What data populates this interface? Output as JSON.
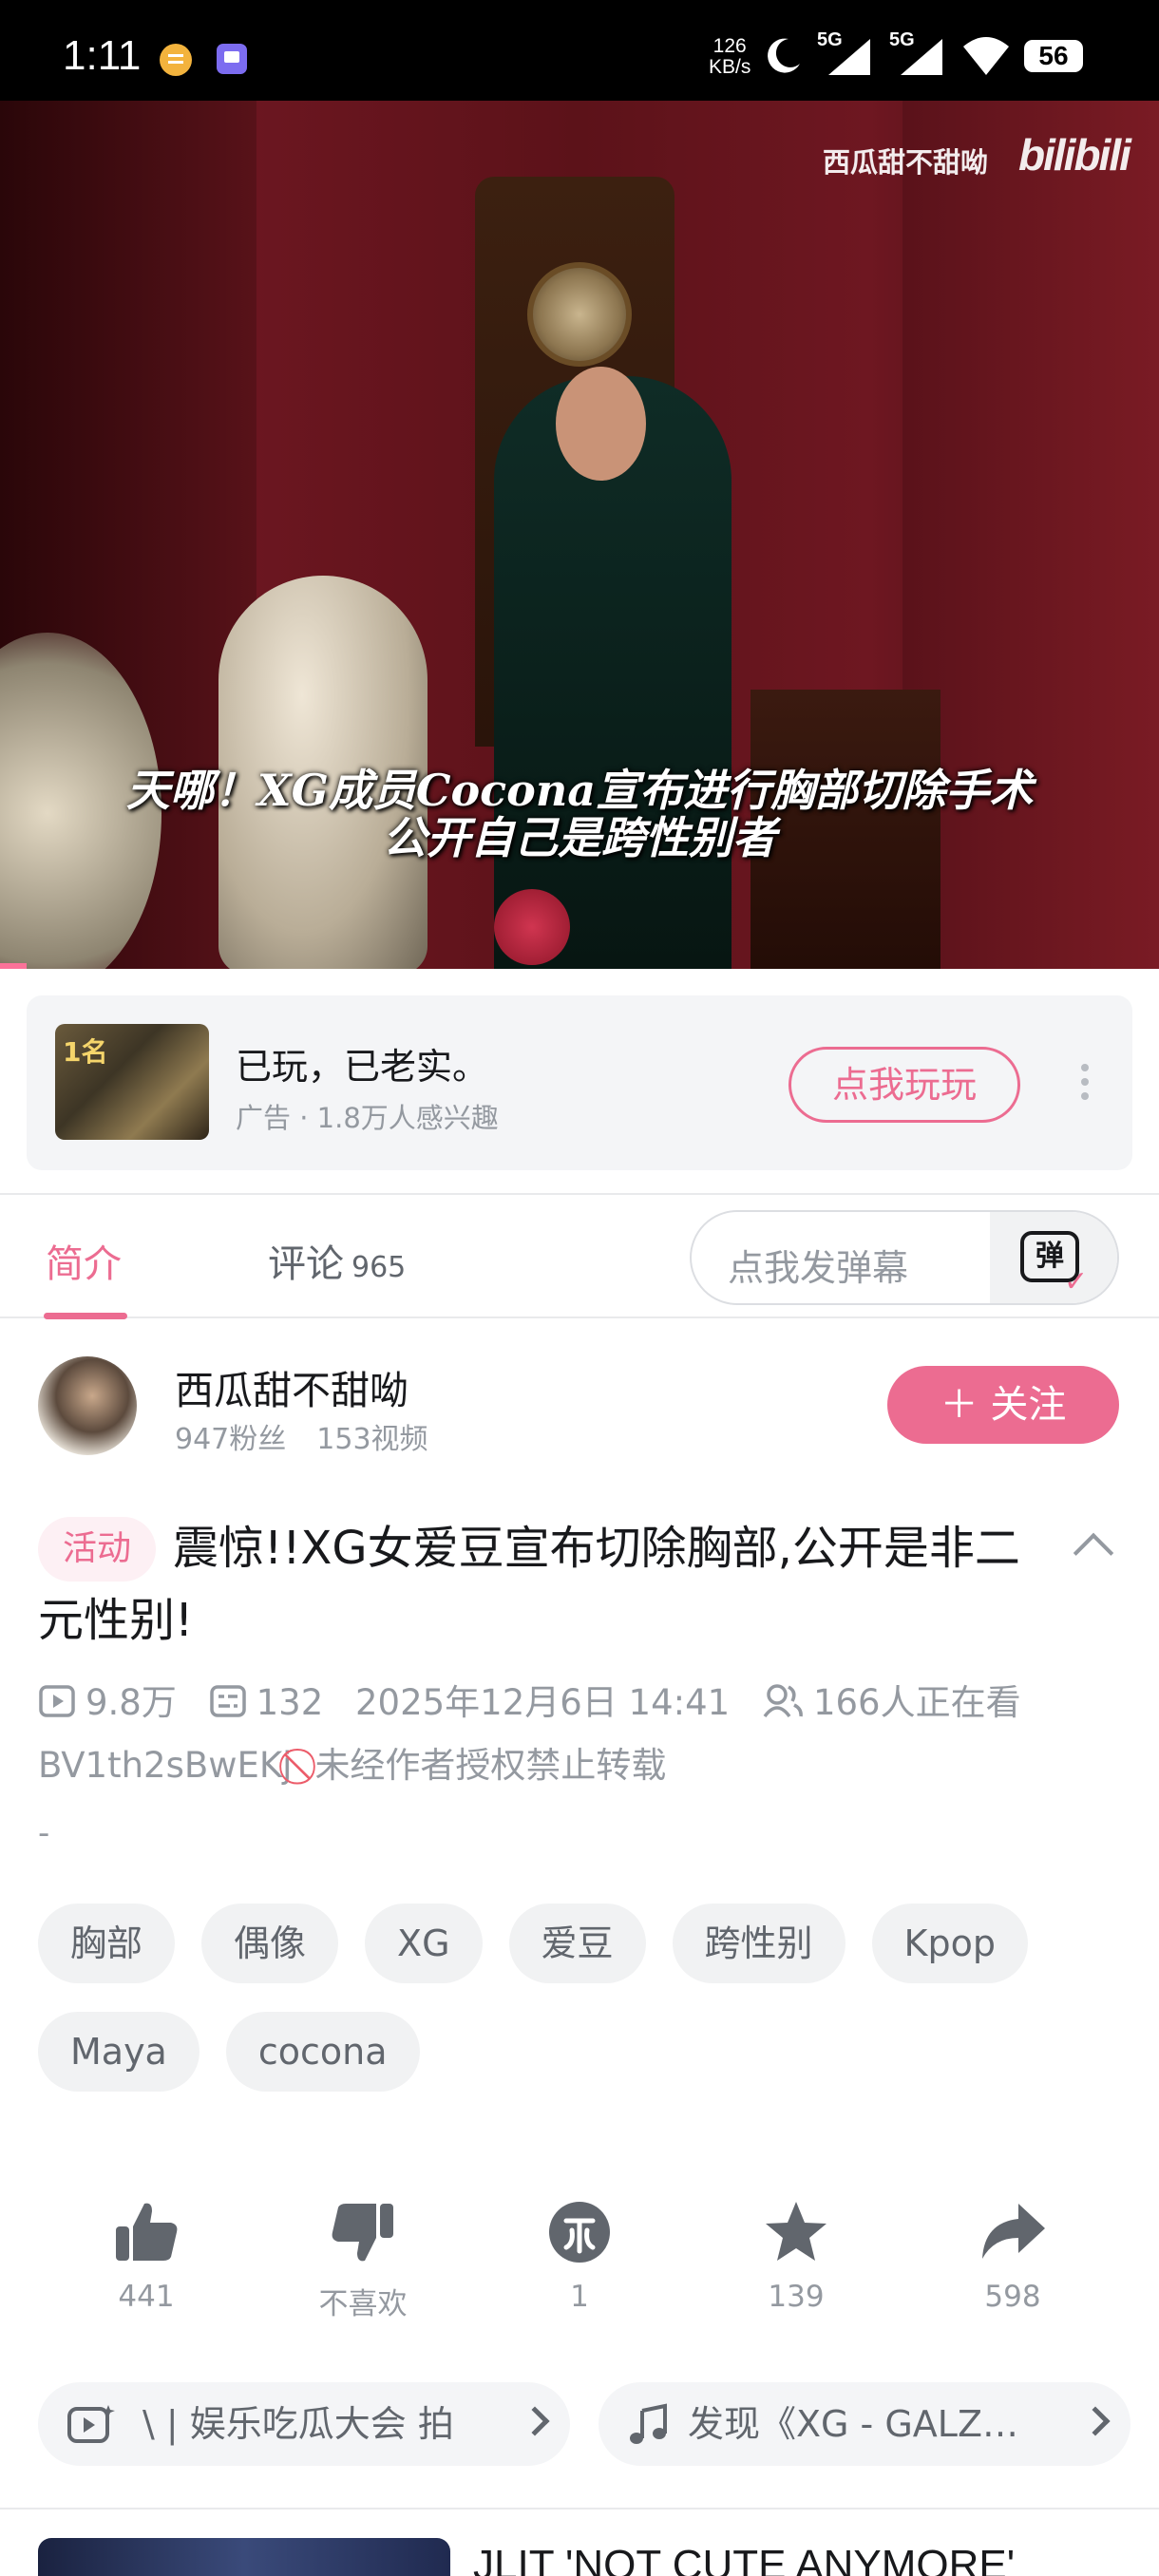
{
  "status_bar": {
    "time": "1:11",
    "speed_value": "126",
    "speed_unit": "KB/s",
    "signal1_label": "5G",
    "signal2_label": "5G",
    "battery": "56"
  },
  "video": {
    "watermark_name": "西瓜甜不甜呦",
    "watermark_logo": "bilibili",
    "subtitle_line1": "天哪！XG成员Cocona宣布进行胸部切除手术",
    "subtitle_line2": "公开自己是跨性别者"
  },
  "ad": {
    "title": "已玩，已老实。",
    "subtitle": "广告 · 1.8万人感兴趣",
    "button_label": "点我玩玩",
    "thumb_rank": "1名"
  },
  "tabs": {
    "intro": "简介",
    "comments": "评论",
    "comments_count": "965",
    "danmaku_placeholder": "点我发弹幕",
    "danmaku_button_glyph": "弹"
  },
  "uploader": {
    "name": "西瓜甜不甜呦",
    "fans": "947粉丝",
    "videos": "153视频",
    "follow_label": "＋ 关注"
  },
  "video_info": {
    "activity_tag": "活动",
    "title": "震惊!!XG女爱豆宣布切除胸部,公开是非二元性别!",
    "views": "9.8万",
    "danmaku_count": "132",
    "publish_time": "2025年12月6日 14:41",
    "watching": "166人正在看",
    "bvid": "BV1th2sBwEKj",
    "copyright_notice": "未经作者授权禁止转载",
    "description": "-"
  },
  "tags": [
    "胸部",
    "偶像",
    "XG",
    "爱豆",
    "跨性别",
    "Kpop",
    "Maya",
    "cocona"
  ],
  "actions": {
    "like": "441",
    "dislike": "不喜欢",
    "coin": "1",
    "favorite": "139",
    "share": "598"
  },
  "links": {
    "activity": "\\ | 娱乐吃瓜大会  拍",
    "music": "发现《XG - GALZ…"
  },
  "recommendation": {
    "title": "JLIT 'NOT CUTE ANYMORE'"
  },
  "colors": {
    "accent": "#ec6c91",
    "text_primary": "#18191c",
    "text_secondary": "#9499a0"
  }
}
